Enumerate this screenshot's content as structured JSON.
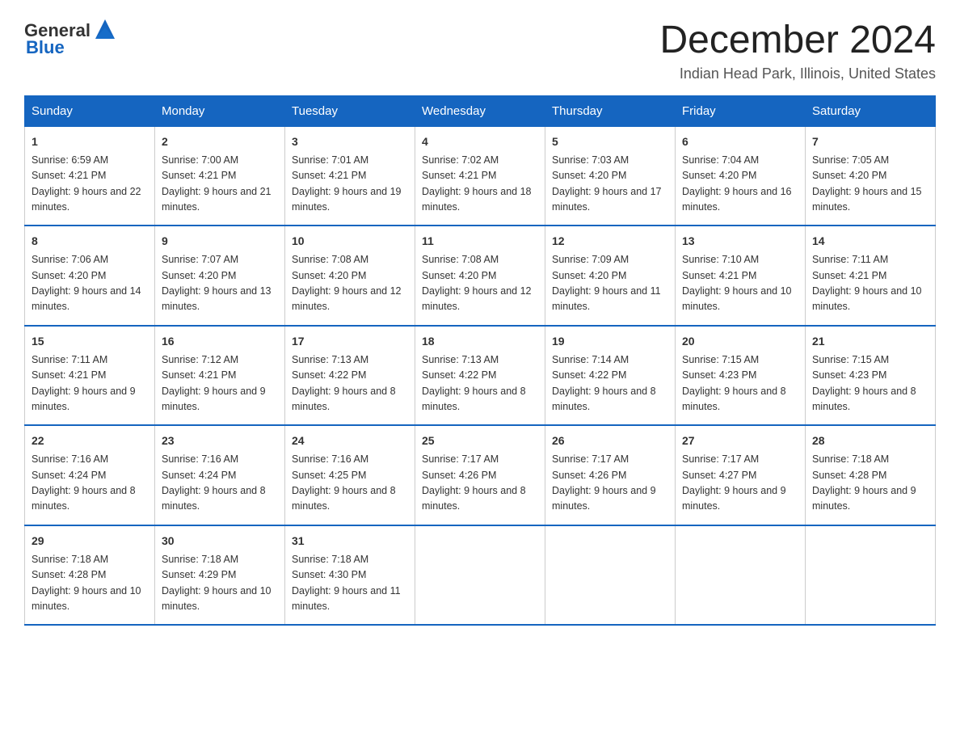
{
  "header": {
    "logo": {
      "general": "General",
      "blue": "Blue"
    },
    "month_title": "December 2024",
    "location": "Indian Head Park, Illinois, United States"
  },
  "days_of_week": [
    "Sunday",
    "Monday",
    "Tuesday",
    "Wednesday",
    "Thursday",
    "Friday",
    "Saturday"
  ],
  "weeks": [
    [
      {
        "day": "1",
        "sunrise": "6:59 AM",
        "sunset": "4:21 PM",
        "daylight": "9 hours and 22 minutes."
      },
      {
        "day": "2",
        "sunrise": "7:00 AM",
        "sunset": "4:21 PM",
        "daylight": "9 hours and 21 minutes."
      },
      {
        "day": "3",
        "sunrise": "7:01 AM",
        "sunset": "4:21 PM",
        "daylight": "9 hours and 19 minutes."
      },
      {
        "day": "4",
        "sunrise": "7:02 AM",
        "sunset": "4:21 PM",
        "daylight": "9 hours and 18 minutes."
      },
      {
        "day": "5",
        "sunrise": "7:03 AM",
        "sunset": "4:20 PM",
        "daylight": "9 hours and 17 minutes."
      },
      {
        "day": "6",
        "sunrise": "7:04 AM",
        "sunset": "4:20 PM",
        "daylight": "9 hours and 16 minutes."
      },
      {
        "day": "7",
        "sunrise": "7:05 AM",
        "sunset": "4:20 PM",
        "daylight": "9 hours and 15 minutes."
      }
    ],
    [
      {
        "day": "8",
        "sunrise": "7:06 AM",
        "sunset": "4:20 PM",
        "daylight": "9 hours and 14 minutes."
      },
      {
        "day": "9",
        "sunrise": "7:07 AM",
        "sunset": "4:20 PM",
        "daylight": "9 hours and 13 minutes."
      },
      {
        "day": "10",
        "sunrise": "7:08 AM",
        "sunset": "4:20 PM",
        "daylight": "9 hours and 12 minutes."
      },
      {
        "day": "11",
        "sunrise": "7:08 AM",
        "sunset": "4:20 PM",
        "daylight": "9 hours and 12 minutes."
      },
      {
        "day": "12",
        "sunrise": "7:09 AM",
        "sunset": "4:20 PM",
        "daylight": "9 hours and 11 minutes."
      },
      {
        "day": "13",
        "sunrise": "7:10 AM",
        "sunset": "4:21 PM",
        "daylight": "9 hours and 10 minutes."
      },
      {
        "day": "14",
        "sunrise": "7:11 AM",
        "sunset": "4:21 PM",
        "daylight": "9 hours and 10 minutes."
      }
    ],
    [
      {
        "day": "15",
        "sunrise": "7:11 AM",
        "sunset": "4:21 PM",
        "daylight": "9 hours and 9 minutes."
      },
      {
        "day": "16",
        "sunrise": "7:12 AM",
        "sunset": "4:21 PM",
        "daylight": "9 hours and 9 minutes."
      },
      {
        "day": "17",
        "sunrise": "7:13 AM",
        "sunset": "4:22 PM",
        "daylight": "9 hours and 8 minutes."
      },
      {
        "day": "18",
        "sunrise": "7:13 AM",
        "sunset": "4:22 PM",
        "daylight": "9 hours and 8 minutes."
      },
      {
        "day": "19",
        "sunrise": "7:14 AM",
        "sunset": "4:22 PM",
        "daylight": "9 hours and 8 minutes."
      },
      {
        "day": "20",
        "sunrise": "7:15 AM",
        "sunset": "4:23 PM",
        "daylight": "9 hours and 8 minutes."
      },
      {
        "day": "21",
        "sunrise": "7:15 AM",
        "sunset": "4:23 PM",
        "daylight": "9 hours and 8 minutes."
      }
    ],
    [
      {
        "day": "22",
        "sunrise": "7:16 AM",
        "sunset": "4:24 PM",
        "daylight": "9 hours and 8 minutes."
      },
      {
        "day": "23",
        "sunrise": "7:16 AM",
        "sunset": "4:24 PM",
        "daylight": "9 hours and 8 minutes."
      },
      {
        "day": "24",
        "sunrise": "7:16 AM",
        "sunset": "4:25 PM",
        "daylight": "9 hours and 8 minutes."
      },
      {
        "day": "25",
        "sunrise": "7:17 AM",
        "sunset": "4:26 PM",
        "daylight": "9 hours and 8 minutes."
      },
      {
        "day": "26",
        "sunrise": "7:17 AM",
        "sunset": "4:26 PM",
        "daylight": "9 hours and 9 minutes."
      },
      {
        "day": "27",
        "sunrise": "7:17 AM",
        "sunset": "4:27 PM",
        "daylight": "9 hours and 9 minutes."
      },
      {
        "day": "28",
        "sunrise": "7:18 AM",
        "sunset": "4:28 PM",
        "daylight": "9 hours and 9 minutes."
      }
    ],
    [
      {
        "day": "29",
        "sunrise": "7:18 AM",
        "sunset": "4:28 PM",
        "daylight": "9 hours and 10 minutes."
      },
      {
        "day": "30",
        "sunrise": "7:18 AM",
        "sunset": "4:29 PM",
        "daylight": "9 hours and 10 minutes."
      },
      {
        "day": "31",
        "sunrise": "7:18 AM",
        "sunset": "4:30 PM",
        "daylight": "9 hours and 11 minutes."
      },
      null,
      null,
      null,
      null
    ]
  ]
}
